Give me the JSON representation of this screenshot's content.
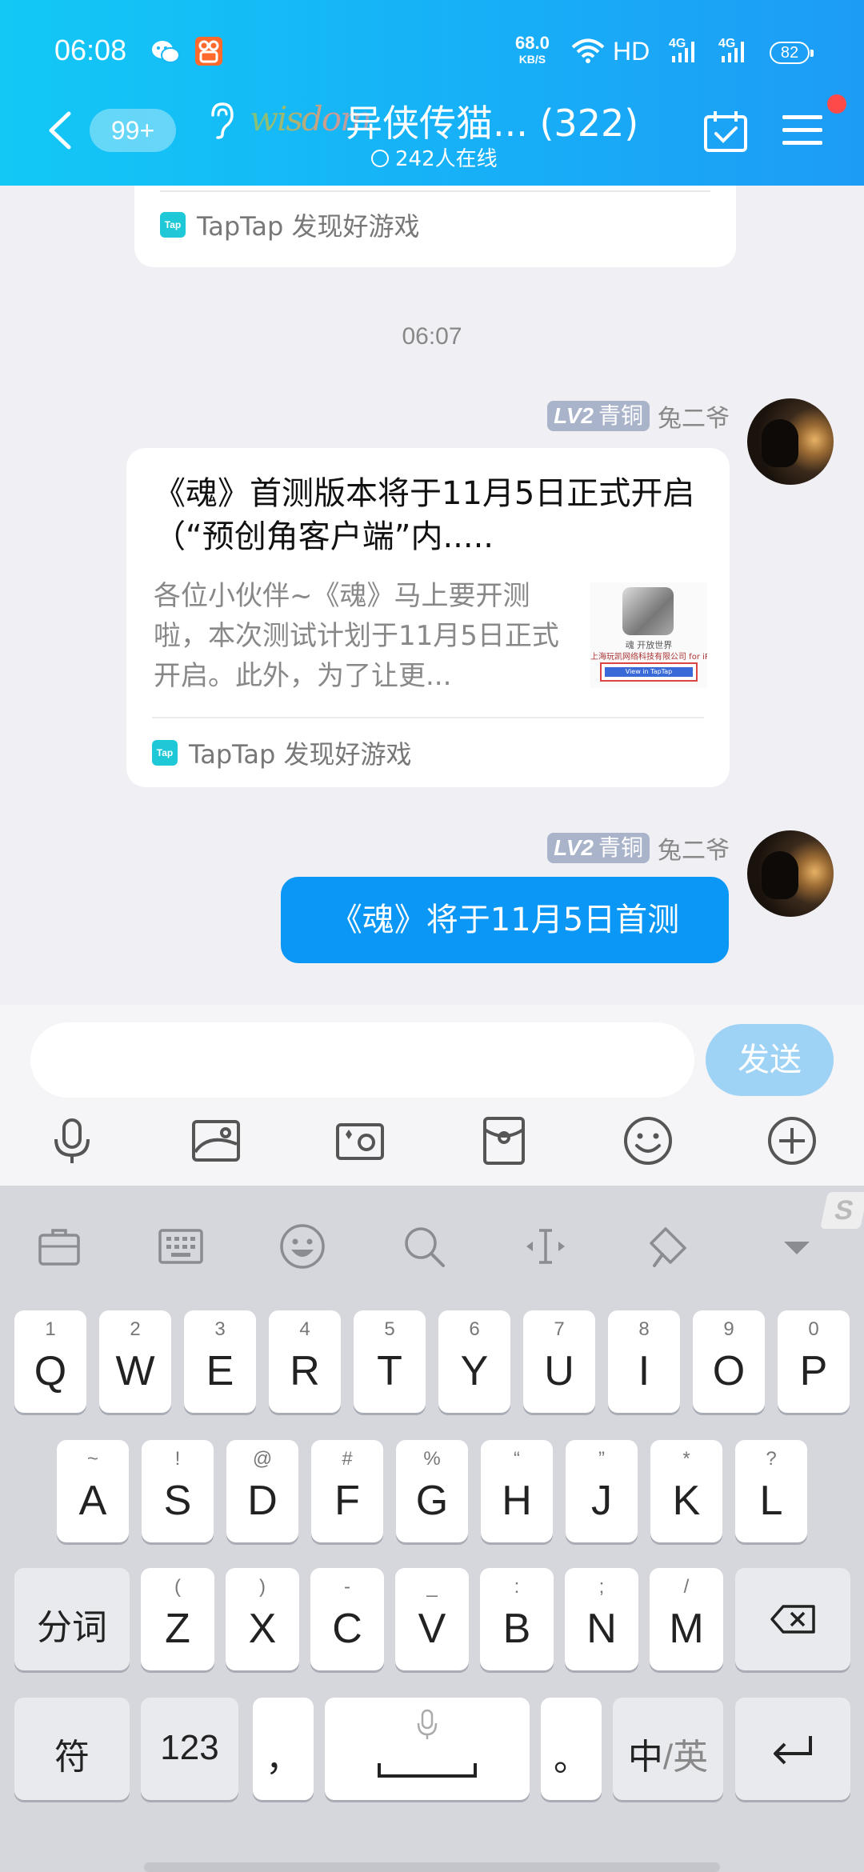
{
  "status_bar": {
    "time": "06:08",
    "net_speed_value": "68.0",
    "net_speed_unit": "KB/S",
    "hd_label": "HD",
    "signal1_label": "4G",
    "signal2_label": "4G",
    "battery": "82",
    "icons": [
      "wechat-icon",
      "kuaishou-icon",
      "wifi-icon",
      "signal-icon",
      "battery-icon"
    ]
  },
  "header": {
    "unread_count": "99+",
    "group_logo_text": "wisdom",
    "group_title": "异侠传猫... (322)",
    "online_text": "242人在线",
    "icons": [
      "back-arrow-icon",
      "ear-icon",
      "calendar-check-icon",
      "menu-icon"
    ],
    "accent_color": "#17b0f7",
    "badge_color": "#ff4a4a"
  },
  "messages": {
    "previous_card_source": "TapTap 发现好游戏",
    "timestamp": "06:07",
    "share_sender_level_code": "LV2",
    "share_sender_level_name": "青铜",
    "share_sender_name": "兔二爷",
    "share_card_title": "《魂》首测版本将于11月5日正式开启（“预创角客户端”内.....",
    "share_card_desc": "各位小伙伴~《魂》马上要开测啦，本次测试计划于11月5日正式开启。此外，为了让更...",
    "share_card_source": "TapTap 发现好游戏",
    "tap_icon_text": "Tap",
    "thumb_game_name": "魂 开放世界",
    "thumb_company": "上海玩凯网络科技有限公司 for iPho",
    "thumb_button": "View in TapTap",
    "text_sender_level_code": "LV2",
    "text_sender_level_name": "青铜",
    "text_sender_name": "兔二爷",
    "text_message": "《魂》将于11月5日首测",
    "bubble_color": "#0a97f5"
  },
  "input_bar": {
    "placeholder": "",
    "send_label": "发送",
    "tools": [
      "microphone-icon",
      "image-icon",
      "camera-icon",
      "red-packet-icon",
      "emoji-icon",
      "plus-icon"
    ]
  },
  "keyboard": {
    "toolbar": [
      "toolbox-icon",
      "keyboard-icon",
      "emoji-icon",
      "search-icon",
      "cursor-icon",
      "brush-icon",
      "collapse-icon"
    ],
    "sogou_badge": "S",
    "row1": [
      {
        "hint": "1",
        "key": "Q"
      },
      {
        "hint": "2",
        "key": "W"
      },
      {
        "hint": "3",
        "key": "E"
      },
      {
        "hint": "4",
        "key": "R"
      },
      {
        "hint": "5",
        "key": "T"
      },
      {
        "hint": "6",
        "key": "Y"
      },
      {
        "hint": "7",
        "key": "U"
      },
      {
        "hint": "8",
        "key": "I"
      },
      {
        "hint": "9",
        "key": "O"
      },
      {
        "hint": "0",
        "key": "P"
      }
    ],
    "row2": [
      {
        "hint": "~",
        "key": "A"
      },
      {
        "hint": "!",
        "key": "S"
      },
      {
        "hint": "@",
        "key": "D"
      },
      {
        "hint": "#",
        "key": "F"
      },
      {
        "hint": "%",
        "key": "G"
      },
      {
        "hint": "“",
        "key": "H"
      },
      {
        "hint": "”",
        "key": "J"
      },
      {
        "hint": "*",
        "key": "K"
      },
      {
        "hint": "?",
        "key": "L"
      }
    ],
    "row3": [
      {
        "hint": "(",
        "key": "Z"
      },
      {
        "hint": ")",
        "key": "X"
      },
      {
        "hint": "-",
        "key": "C"
      },
      {
        "hint": "_",
        "key": "V"
      },
      {
        "hint": ":",
        "key": "B"
      },
      {
        "hint": ";",
        "key": "N"
      },
      {
        "hint": "/",
        "key": "M"
      }
    ],
    "fenci_label": "分词",
    "fu_label": "符",
    "num_label": "123",
    "comma_label": "，",
    "period_label": "。",
    "lang_cn": "中",
    "lang_sep": "/",
    "lang_en": "英"
  }
}
